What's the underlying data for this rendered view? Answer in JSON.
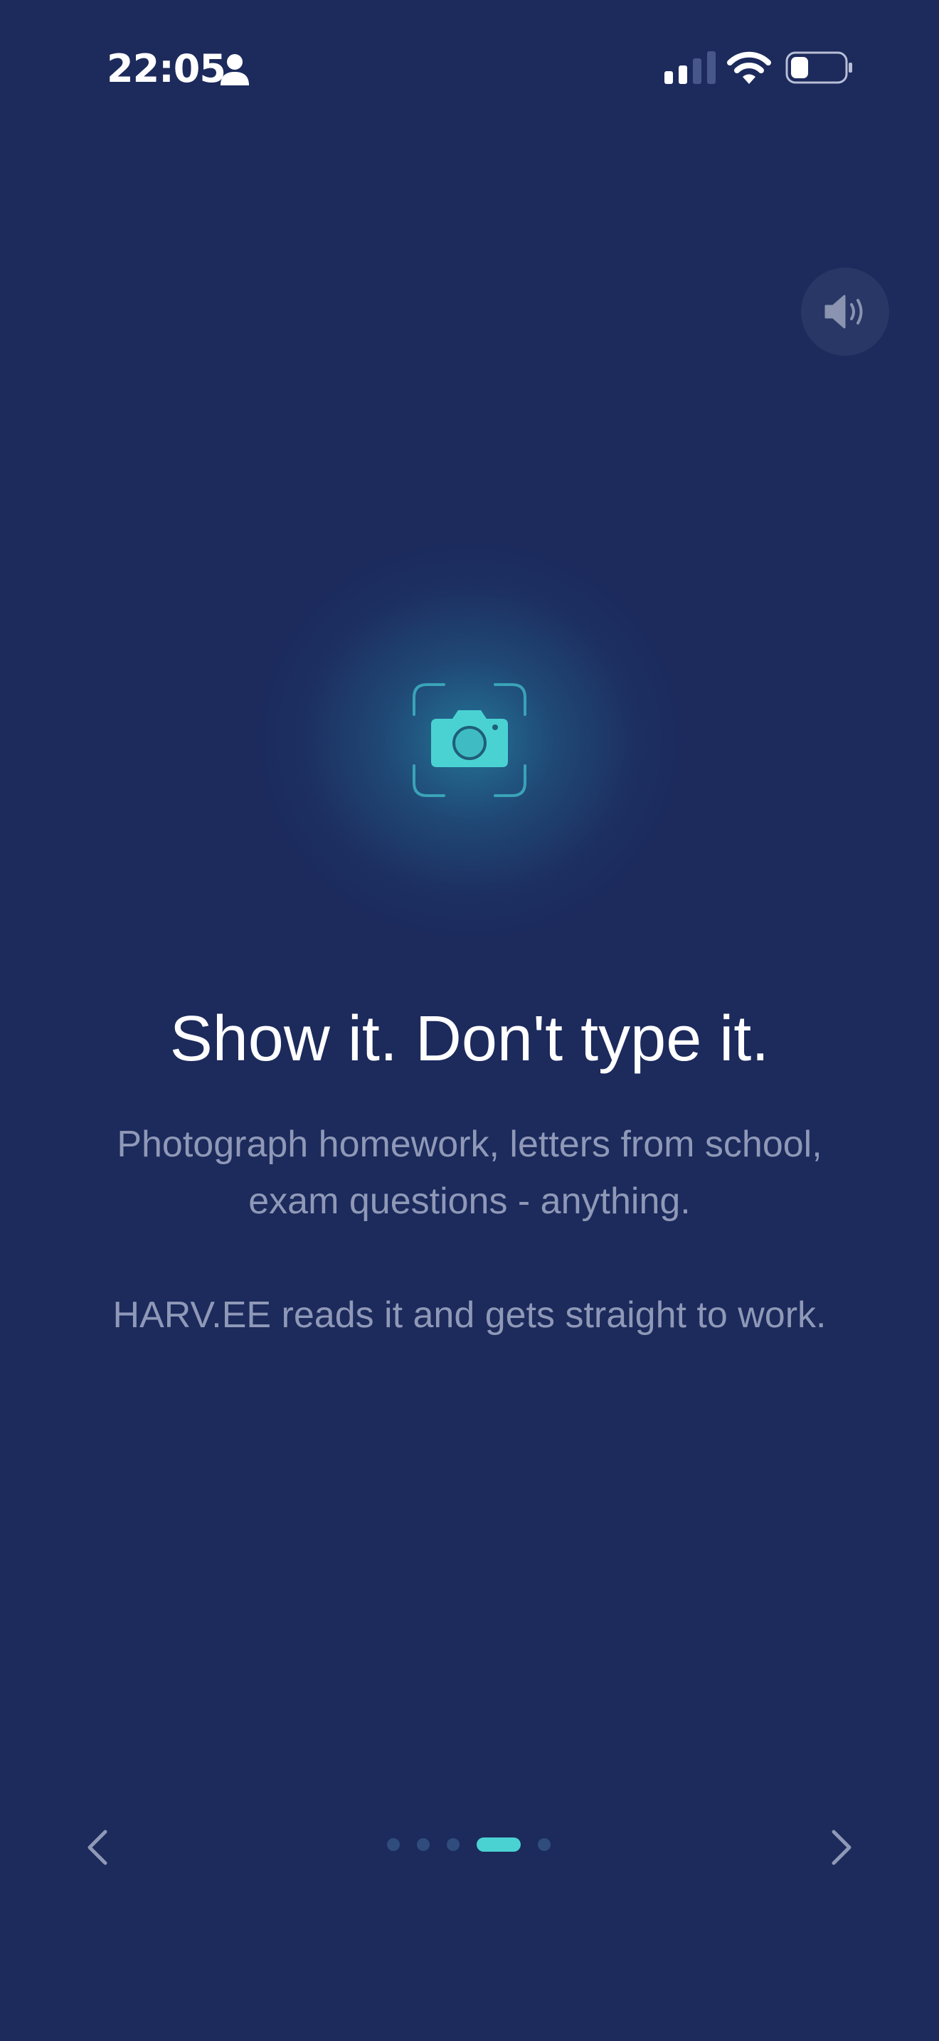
{
  "status_bar": {
    "time": "22:05"
  },
  "onboarding": {
    "title": "Show it. Don't type it.",
    "subtitle": "Photograph homework, letters from school, exam questions - anything.",
    "detail": "HARV.EE reads it and gets straight to work."
  },
  "pager": {
    "total": 5,
    "active_index": 3
  },
  "colors": {
    "background": "#1c2a5c",
    "accent": "#4ad2d2",
    "muted_text": "#8f99b7",
    "dot_inactive": "#2f4c7c"
  },
  "icons": {
    "sound": "speaker-icon",
    "camera": "camera-icon",
    "prev": "chevron-left-icon",
    "next": "chevron-right-icon"
  }
}
